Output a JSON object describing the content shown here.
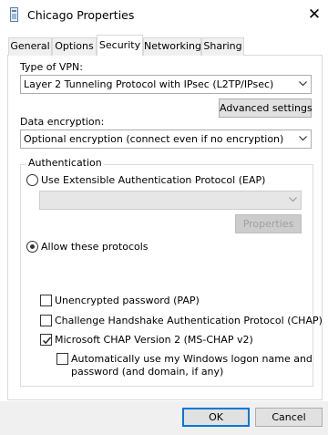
{
  "window": {
    "title": "Chicago Properties",
    "close_glyph": "✕",
    "app_icon": "network-connection-icon"
  },
  "tabs": [
    {
      "label": "General"
    },
    {
      "label": "Options"
    },
    {
      "label": "Security",
      "active": true
    },
    {
      "label": "Networking"
    },
    {
      "label": "Sharing"
    }
  ],
  "security": {
    "vpn_type_label": "Type of VPN:",
    "vpn_type_value": "Layer 2 Tunneling Protocol with IPsec (L2TP/IPsec)",
    "advanced_settings_label": "Advanced settings",
    "data_encryption_label": "Data encryption:",
    "data_encryption_value": "Optional encryption (connect even if no encryption)",
    "authentication_group_label": "Authentication",
    "eap_radio_label": "Use Extensible Authentication Protocol (EAP)",
    "eap_selected": false,
    "eap_combo_value": "",
    "properties_label": "Properties",
    "allow_protocols_label": "Allow these protocols",
    "allow_protocols_selected": true,
    "protocols": [
      {
        "label": "Unencrypted password (PAP)",
        "checked": false
      },
      {
        "label": "Challenge Handshake Authentication Protocol (CHAP)",
        "checked": false
      },
      {
        "label": "Microsoft CHAP Version 2 (MS-CHAP v2)",
        "checked": true
      }
    ],
    "auto_logon_label_line1": "Automatically use my Windows logon name and",
    "auto_logon_label_line2": "password (and domain, if any)",
    "auto_logon_checked": false
  },
  "buttons": {
    "ok": "OK",
    "cancel": "Cancel"
  },
  "colors": {
    "accent": "#0078d7",
    "border": "#adadad",
    "button_face": "#e1e1e1",
    "disabled_text": "#a0a0a0"
  }
}
